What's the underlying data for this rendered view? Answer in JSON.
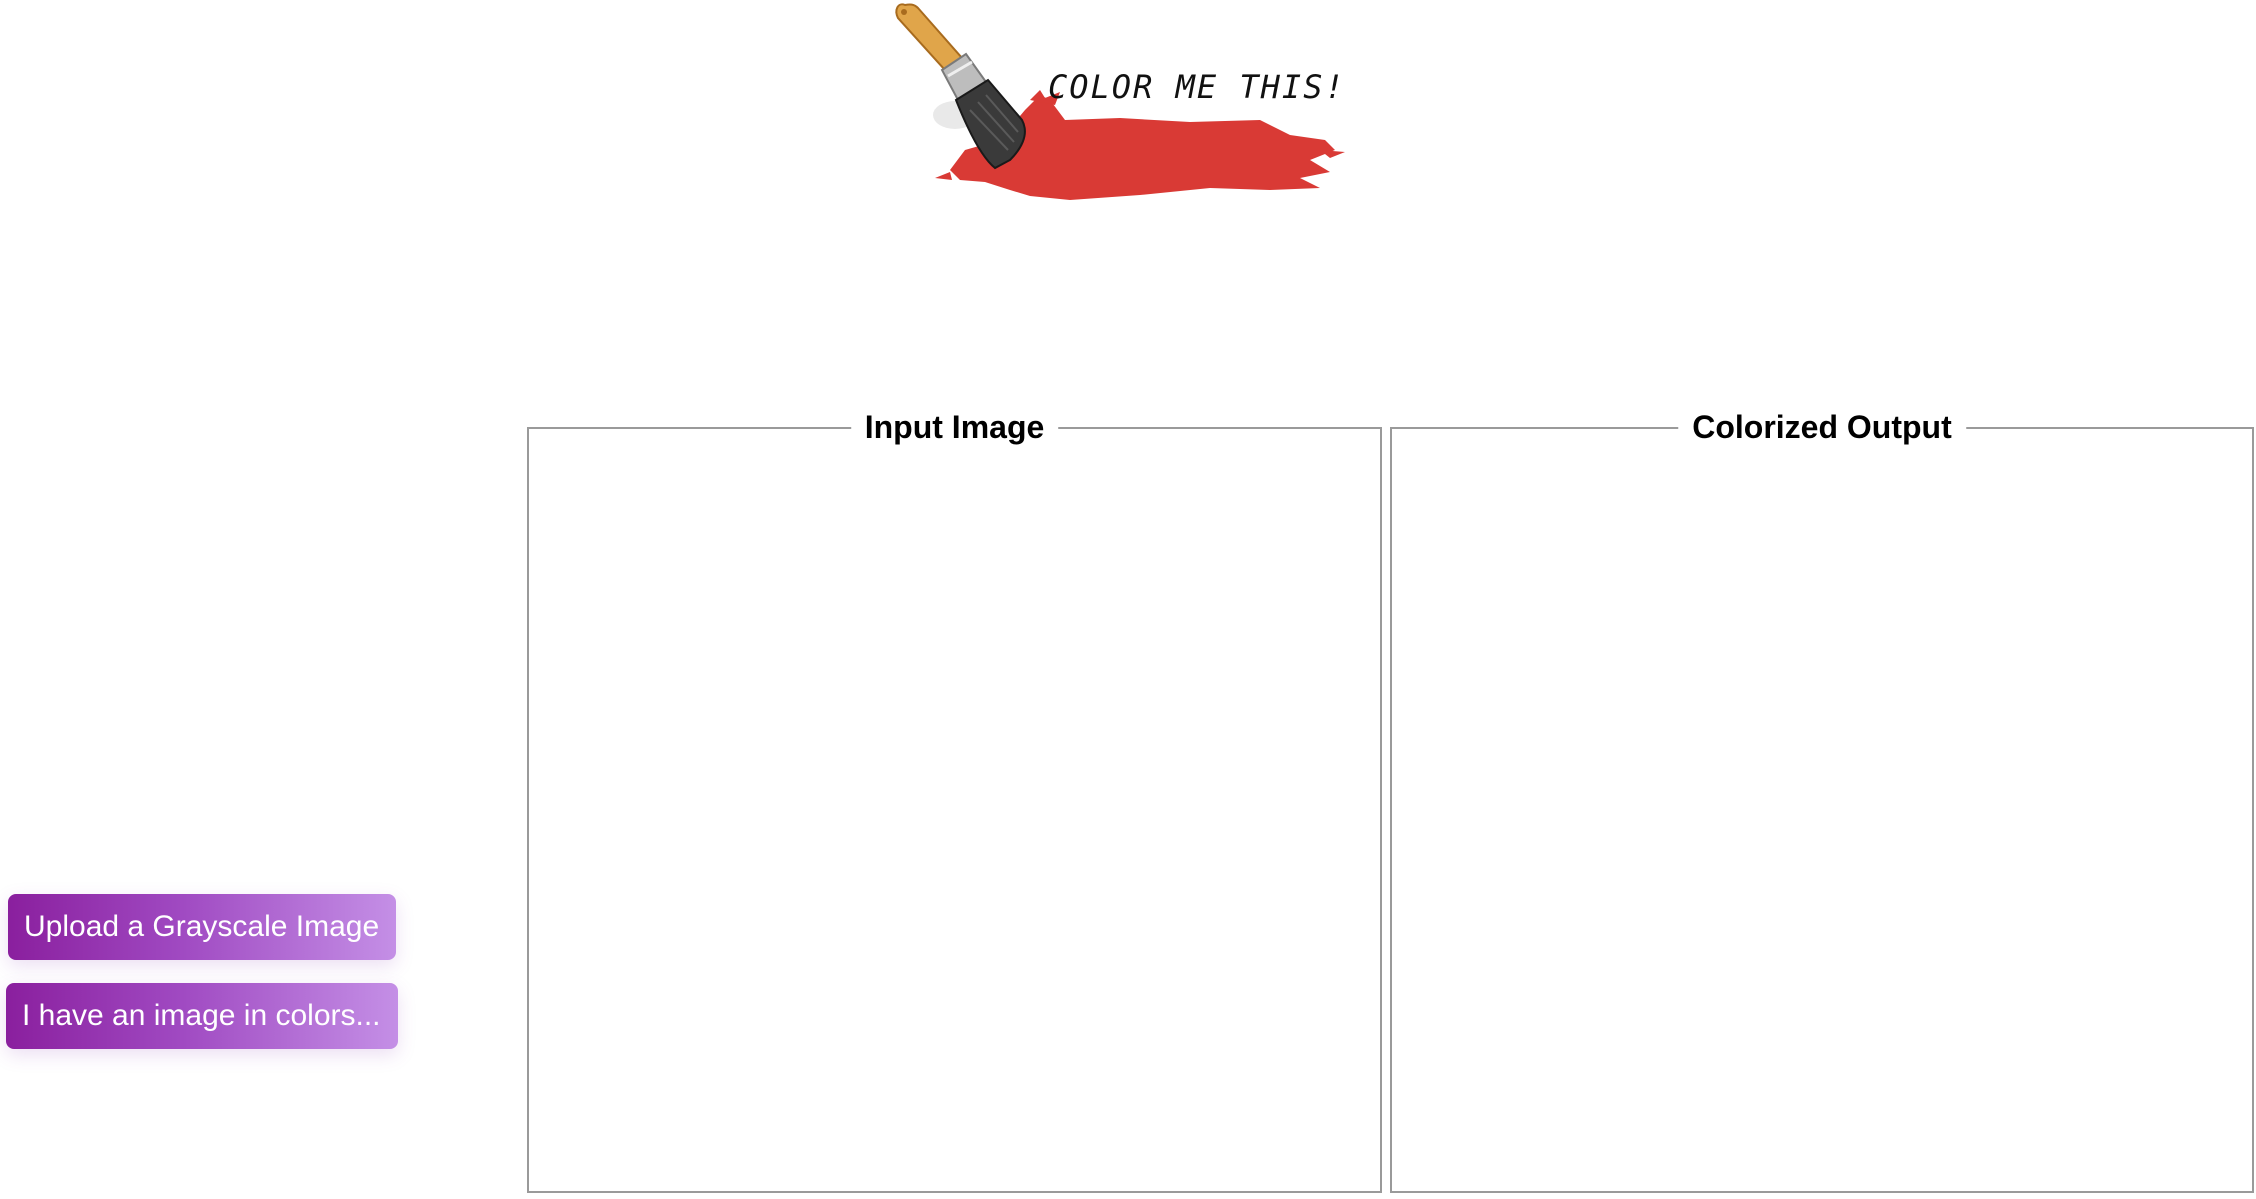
{
  "header": {
    "logo_text": "COLOR ME THIS!",
    "logo_icon": "paintbrush-icon",
    "brand_color": "#d93a35"
  },
  "panels": {
    "input_title": "Input Image",
    "output_title": "Colorized Output"
  },
  "actions": {
    "upload_label": "Upload a Grayscale Image",
    "colors_label": "I have an image in colors..."
  },
  "colors": {
    "button_gradient_start": "#8a1f9e",
    "button_gradient_end": "#c48fe6",
    "panel_border": "#9a9a9a"
  }
}
